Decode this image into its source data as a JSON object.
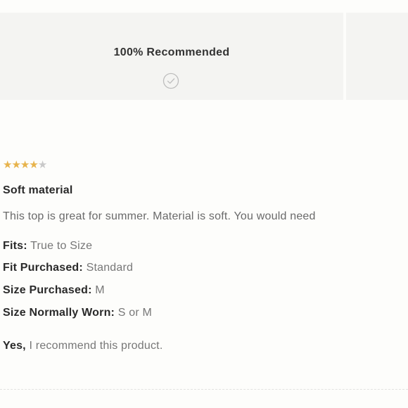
{
  "summary": {
    "recommended_text": "100% Recommended",
    "icon": "check-circle-icon"
  },
  "review": {
    "rating": 4,
    "max_rating": 5,
    "title": "Soft material",
    "body": "This top is great for summer. Material is soft. You would need",
    "attributes": [
      {
        "label": "Fits:",
        "value": "True to Size"
      },
      {
        "label": "Fit Purchased:",
        "value": "Standard"
      },
      {
        "label": "Size Purchased:",
        "value": "M"
      },
      {
        "label": "Size Normally Worn:",
        "value": "S or M"
      }
    ],
    "recommendation": {
      "answer": "Yes,",
      "text": "I recommend this product."
    }
  },
  "colors": {
    "star_filled": "#e7b34b",
    "star_empty": "#c9c9c9",
    "panel_bg": "#f4f4f2"
  }
}
